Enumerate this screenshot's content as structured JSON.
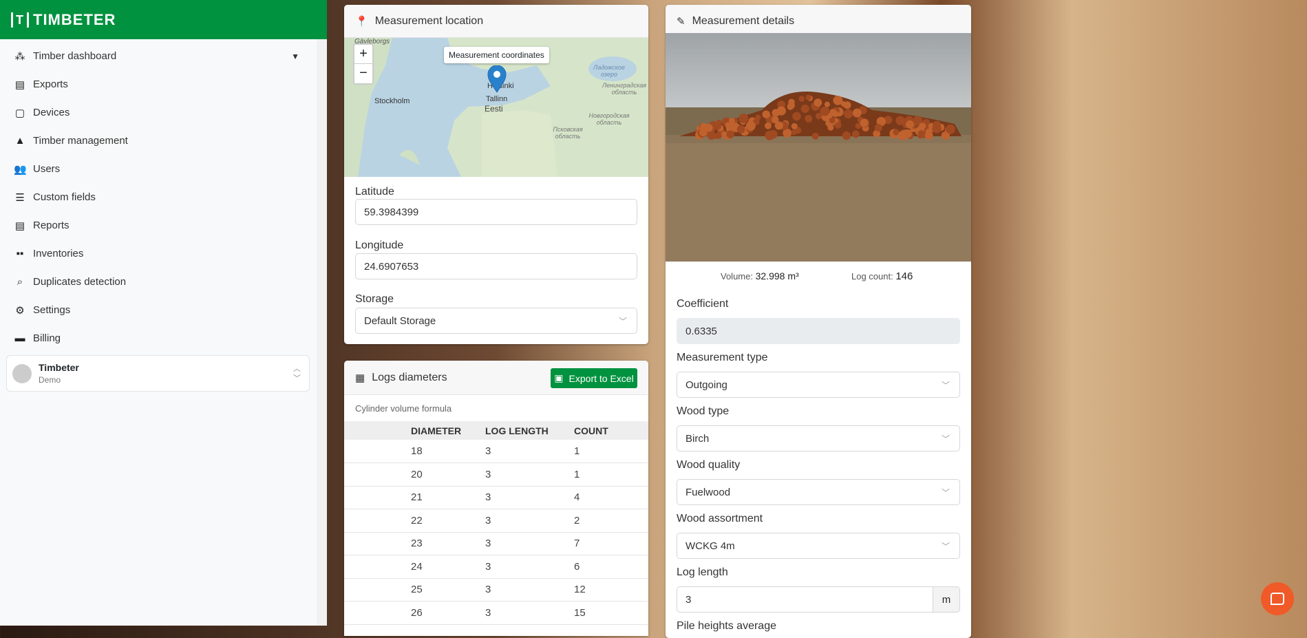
{
  "brand": {
    "name": "TIMBETER",
    "accent": "#00923f"
  },
  "sidebar": {
    "items": [
      {
        "label": "Timber dashboard",
        "icon": "sitemap-icon",
        "expandable": true
      },
      {
        "label": "Exports",
        "icon": "file-export-icon"
      },
      {
        "label": "Devices",
        "icon": "tablet-icon"
      },
      {
        "label": "Timber management",
        "icon": "tree-icon"
      },
      {
        "label": "Users",
        "icon": "users-icon"
      },
      {
        "label": "Custom fields",
        "icon": "list-icon"
      },
      {
        "label": "Reports",
        "icon": "file-alt-icon"
      },
      {
        "label": "Inventories",
        "icon": "boxes-icon"
      },
      {
        "label": "Duplicates detection",
        "icon": "search-icon"
      },
      {
        "label": "Settings",
        "icon": "cog-icon"
      },
      {
        "label": "Billing",
        "icon": "credit-card-icon"
      }
    ],
    "profile": {
      "name": "Timbeter",
      "org": "Demo"
    }
  },
  "location": {
    "title": "Measurement location",
    "map": {
      "tooltip": "Measurement coordinates",
      "zoom_in": "+",
      "zoom_out": "−",
      "labels": [
        "Gävleborgs",
        "Stockholm",
        "Helsinki",
        "Tallinn",
        "Eesti",
        "Ладожское озеро",
        "Ленинградская область",
        "Новгородская область",
        "Псковская область"
      ]
    },
    "latitude_label": "Latitude",
    "latitude": "59.3984399",
    "longitude_label": "Longitude",
    "longitude": "24.6907653",
    "storage_label": "Storage",
    "storage": "Default Storage"
  },
  "logs": {
    "title": "Logs diameters",
    "export_label": "Export to Excel",
    "formula": "Cylinder volume formula",
    "columns": [
      "DIAMETER",
      "LOG LENGTH",
      "COUNT"
    ],
    "rows": [
      [
        "18",
        "3",
        "1"
      ],
      [
        "20",
        "3",
        "1"
      ],
      [
        "21",
        "3",
        "4"
      ],
      [
        "22",
        "3",
        "2"
      ],
      [
        "23",
        "3",
        "7"
      ],
      [
        "24",
        "3",
        "6"
      ],
      [
        "25",
        "3",
        "12"
      ],
      [
        "26",
        "3",
        "15"
      ]
    ]
  },
  "details": {
    "title": "Measurement details",
    "volume_label": "Volume:",
    "volume": "32.998 m³",
    "log_count_label": "Log count:",
    "log_count": "146",
    "coefficient_label": "Coefficient",
    "coefficient": "0.6335",
    "measurement_type_label": "Measurement type",
    "measurement_type": "Outgoing",
    "wood_type_label": "Wood type",
    "wood_type": "Birch",
    "wood_quality_label": "Wood quality",
    "wood_quality": "Fuelwood",
    "assortment_label": "Wood assortment",
    "assortment": "WCKG 4m",
    "log_length_label": "Log length",
    "log_length": "3",
    "log_length_unit": "m",
    "pile_heights_label": "Pile heights average"
  }
}
